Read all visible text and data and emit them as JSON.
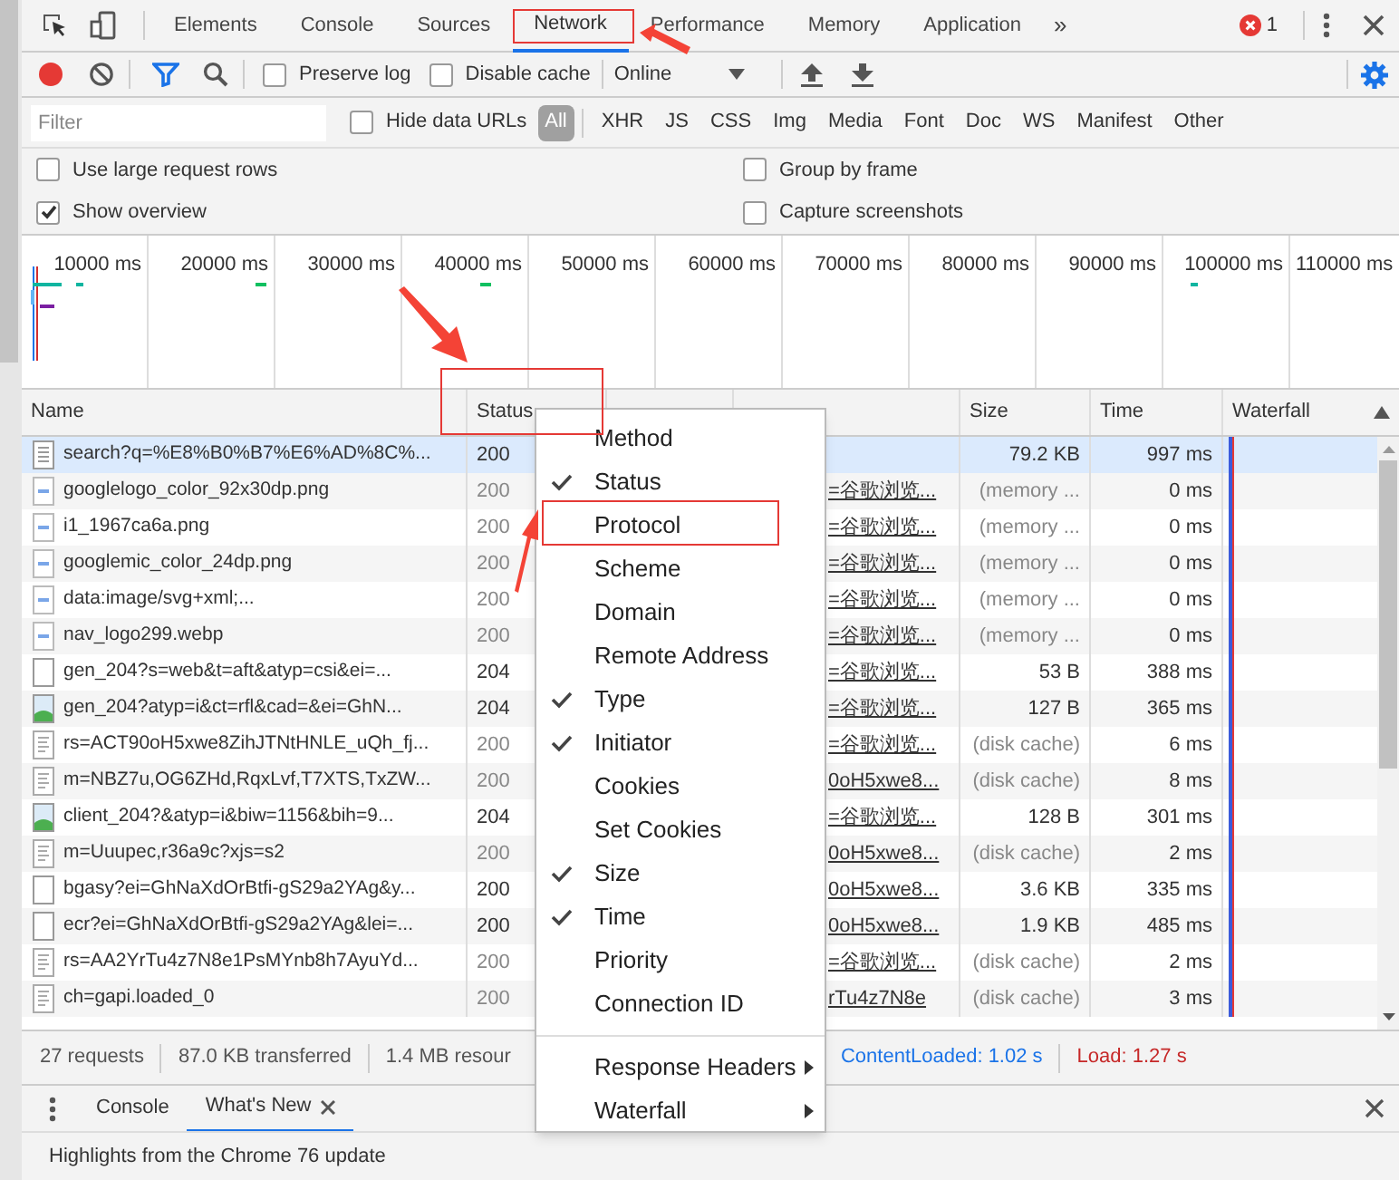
{
  "tabs": [
    {
      "label": "Elements",
      "selected": false
    },
    {
      "label": "Console",
      "selected": false
    },
    {
      "label": "Sources",
      "selected": false
    },
    {
      "label": "Network",
      "selected": true
    },
    {
      "label": "Performance",
      "selected": false
    },
    {
      "label": "Memory",
      "selected": false
    },
    {
      "label": "Application",
      "selected": false
    }
  ],
  "more_tabs": "»",
  "error_count": "1",
  "toolbar": {
    "recording": true,
    "filter_active": true,
    "preserve_log": {
      "label": "Preserve log",
      "checked": false
    },
    "disable_cache": {
      "label": "Disable cache",
      "checked": false
    },
    "throttling": "Online"
  },
  "filter": {
    "placeholder": "Filter",
    "hide_data_urls": {
      "label": "Hide data URLs",
      "checked": false
    },
    "types": [
      {
        "label": "All",
        "selected": true
      },
      {
        "label": "XHR",
        "selected": false
      },
      {
        "label": "JS",
        "selected": false
      },
      {
        "label": "CSS",
        "selected": false
      },
      {
        "label": "Img",
        "selected": false
      },
      {
        "label": "Media",
        "selected": false
      },
      {
        "label": "Font",
        "selected": false
      },
      {
        "label": "Doc",
        "selected": false
      },
      {
        "label": "WS",
        "selected": false
      },
      {
        "label": "Manifest",
        "selected": false
      },
      {
        "label": "Other",
        "selected": false
      }
    ]
  },
  "settings": [
    {
      "label": "Use large request rows",
      "checked": false
    },
    {
      "label": "Group by frame",
      "checked": false
    },
    {
      "label": "Show overview",
      "checked": true
    },
    {
      "label": "Capture screenshots",
      "checked": false
    }
  ],
  "overview": {
    "ticks": [
      "10000 ms",
      "20000 ms",
      "30000 ms",
      "40000 ms",
      "50000 ms",
      "60000 ms",
      "70000 ms",
      "80000 ms",
      "90000 ms",
      "100000 ms",
      "110000 ms"
    ]
  },
  "table": {
    "columns": {
      "name": "Name",
      "status": "Status",
      "size": "Size",
      "time": "Time",
      "waterfall": "Waterfall"
    },
    "rows": [
      {
        "kind": "document",
        "name": "search?q=%E8%B0%B7%E6%AD%8C%...",
        "status": "200",
        "size": "79.2 KB",
        "cached": false,
        "time": "997 ms",
        "selected": true
      },
      {
        "kind": "image",
        "name": "googlelogo_color_92x30dp.png",
        "status": "200",
        "initiator": "=谷歌浏览...",
        "size": "(memory ...",
        "cached": true,
        "time": "0 ms",
        "selected": false
      },
      {
        "kind": "image",
        "name": "i1_1967ca6a.png",
        "status": "200",
        "initiator": "=谷歌浏览...",
        "size": "(memory ...",
        "cached": true,
        "time": "0 ms",
        "selected": false
      },
      {
        "kind": "image",
        "name": "googlemic_color_24dp.png",
        "status": "200",
        "initiator": "=谷歌浏览...",
        "size": "(memory ...",
        "cached": true,
        "time": "0 ms",
        "selected": false
      },
      {
        "kind": "image",
        "name": "data:image/svg+xml;...",
        "status": "200",
        "initiator": "=谷歌浏览...",
        "size": "(memory ...",
        "cached": true,
        "time": "0 ms",
        "selected": false
      },
      {
        "kind": "image",
        "name": "nav_logo299.webp",
        "status": "200",
        "initiator": "=谷歌浏览...",
        "size": "(memory ...",
        "cached": true,
        "time": "0 ms",
        "selected": false
      },
      {
        "kind": "blank",
        "name": "gen_204?s=web&t=aft&atyp=csi&ei=...",
        "status": "204",
        "initiator": "=谷歌浏览...",
        "size": "53 B",
        "cached": false,
        "time": "388 ms",
        "selected": false
      },
      {
        "kind": "photo",
        "name": "gen_204?atyp=i&ct=rfl&cad=&ei=GhN...",
        "status": "204",
        "initiator": "=谷歌浏览...",
        "size": "127 B",
        "cached": false,
        "time": "365 ms",
        "selected": false
      },
      {
        "kind": "script",
        "name": "rs=ACT90oH5xwe8ZihJTNtHNLE_uQh_fj...",
        "status": "200",
        "initiator": "=谷歌浏览...",
        "size": "(disk cache)",
        "cached": true,
        "time": "6 ms",
        "selected": false
      },
      {
        "kind": "script",
        "name": "m=NBZ7u,OG6ZHd,RqxLvf,T7XTS,TxZW...",
        "status": "200",
        "initiator": "0oH5xwe8...",
        "size": "(disk cache)",
        "cached": true,
        "time": "8 ms",
        "selected": false
      },
      {
        "kind": "photo",
        "name": "client_204?&atyp=i&biw=1156&bih=9...",
        "status": "204",
        "initiator": "=谷歌浏览...",
        "size": "128 B",
        "cached": false,
        "time": "301 ms",
        "selected": false
      },
      {
        "kind": "script",
        "name": "m=Uuupec,r36a9c?xjs=s2",
        "status": "200",
        "initiator": "0oH5xwe8...",
        "size": "(disk cache)",
        "cached": true,
        "time": "2 ms",
        "selected": false
      },
      {
        "kind": "blank",
        "name": "bgasy?ei=GhNaXdOrBtfi-gS29a2YAg&y...",
        "status": "200",
        "initiator": "0oH5xwe8...",
        "size": "3.6 KB",
        "cached": false,
        "time": "335 ms",
        "selected": false
      },
      {
        "kind": "blank",
        "name": "ecr?ei=GhNaXdOrBtfi-gS29a2YAg&lei=...",
        "status": "200",
        "initiator": "0oH5xwe8...",
        "size": "1.9 KB",
        "cached": false,
        "time": "485 ms",
        "selected": false
      },
      {
        "kind": "script",
        "name": "rs=AA2YrTu4z7N8e1PsMYnb8h7AyuYd...",
        "status": "200",
        "initiator": "=谷歌浏览...",
        "size": "(disk cache)",
        "cached": true,
        "time": "2 ms",
        "selected": false
      },
      {
        "kind": "script",
        "name": "ch=gapi.loaded_0",
        "status": "200",
        "initiator": "rTu4z7N8e",
        "size": "(disk cache)",
        "cached": true,
        "time": "3 ms",
        "selected": false
      }
    ]
  },
  "status_bar": [
    {
      "kind": "plain",
      "text": "27 requests"
    },
    {
      "kind": "plain",
      "text": "87.0 KB transferred"
    },
    {
      "kind": "plain",
      "text": "1.4 MB resour"
    },
    {
      "kind": "domcontentloaded",
      "text": "ContentLoaded: 1.02 s"
    },
    {
      "kind": "load",
      "text": "Load: 1.27 s"
    }
  ],
  "drawer": {
    "tabs": [
      {
        "label": "Console",
        "selected": false,
        "closable": false
      },
      {
        "label": "What's New",
        "selected": true,
        "closable": true
      }
    ],
    "content": "Highlights from the Chrome 76 update"
  },
  "context_menu": [
    {
      "label": "Method",
      "checked": false,
      "submenu": false
    },
    {
      "label": "Status",
      "checked": true,
      "submenu": false
    },
    {
      "label": "Protocol",
      "checked": false,
      "submenu": false
    },
    {
      "label": "Scheme",
      "checked": false,
      "submenu": false
    },
    {
      "label": "Domain",
      "checked": false,
      "submenu": false
    },
    {
      "label": "Remote Address",
      "checked": false,
      "submenu": false
    },
    {
      "label": "Type",
      "checked": true,
      "submenu": false
    },
    {
      "label": "Initiator",
      "checked": true,
      "submenu": false
    },
    {
      "label": "Cookies",
      "checked": false,
      "submenu": false
    },
    {
      "label": "Set Cookies",
      "checked": false,
      "submenu": false
    },
    {
      "label": "Size",
      "checked": true,
      "submenu": false
    },
    {
      "label": "Time",
      "checked": true,
      "submenu": false
    },
    {
      "label": "Priority",
      "checked": false,
      "submenu": false
    },
    {
      "label": "Connection ID",
      "checked": false,
      "submenu": false
    },
    {
      "label": "Response Headers",
      "checked": false,
      "submenu": true
    },
    {
      "label": "Waterfall",
      "checked": false,
      "submenu": true
    }
  ]
}
